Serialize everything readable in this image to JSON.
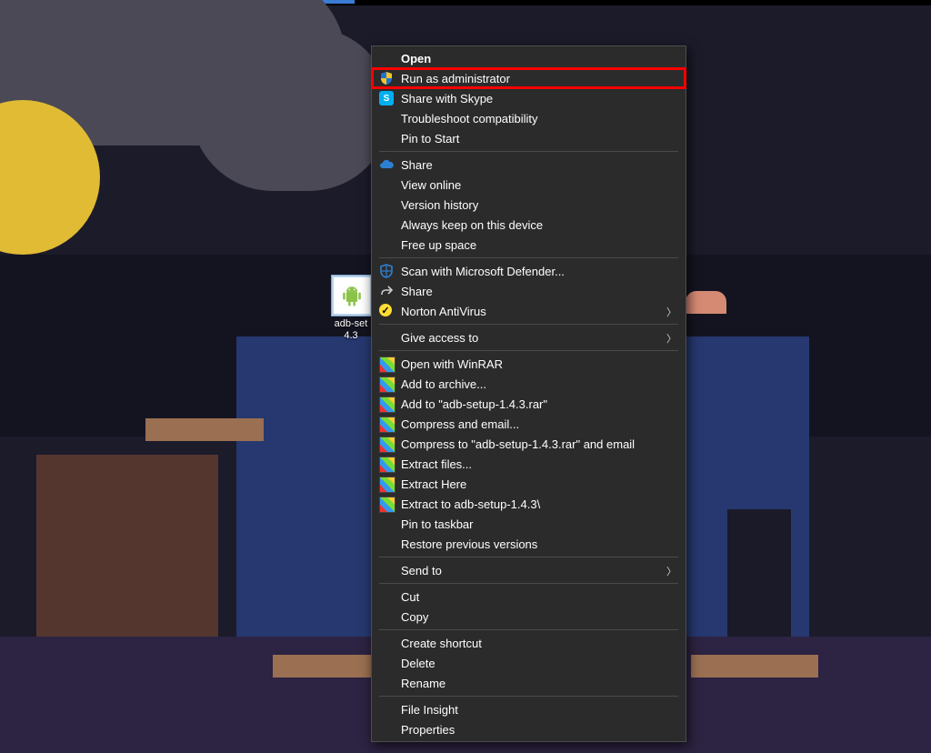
{
  "desktop_icon": {
    "label_line1": "adb-set",
    "label_line2": "4.3"
  },
  "context_menu": {
    "open": "Open",
    "run_as_admin": "Run as administrator",
    "share_skype": "Share with Skype",
    "troubleshoot": "Troubleshoot compatibility",
    "pin_start": "Pin to Start",
    "share_cloud": "Share",
    "view_online": "View online",
    "version_history": "Version history",
    "always_keep": "Always keep on this device",
    "free_up": "Free up space",
    "defender": "Scan with Microsoft Defender...",
    "share_generic": "Share",
    "norton": "Norton AntiVirus",
    "give_access": "Give access to",
    "open_winrar": "Open with WinRAR",
    "add_archive": "Add to archive...",
    "add_to_rar": "Add to \"adb-setup-1.4.3.rar\"",
    "compress_email": "Compress and email...",
    "compress_to_email": "Compress to \"adb-setup-1.4.3.rar\" and email",
    "extract_files": "Extract files...",
    "extract_here": "Extract Here",
    "extract_to": "Extract to adb-setup-1.4.3\\",
    "pin_taskbar": "Pin to taskbar",
    "restore_prev": "Restore previous versions",
    "send_to": "Send to",
    "cut": "Cut",
    "copy": "Copy",
    "create_shortcut": "Create shortcut",
    "delete": "Delete",
    "rename": "Rename",
    "file_insight": "File Insight",
    "properties": "Properties"
  },
  "skype_letter": "S"
}
